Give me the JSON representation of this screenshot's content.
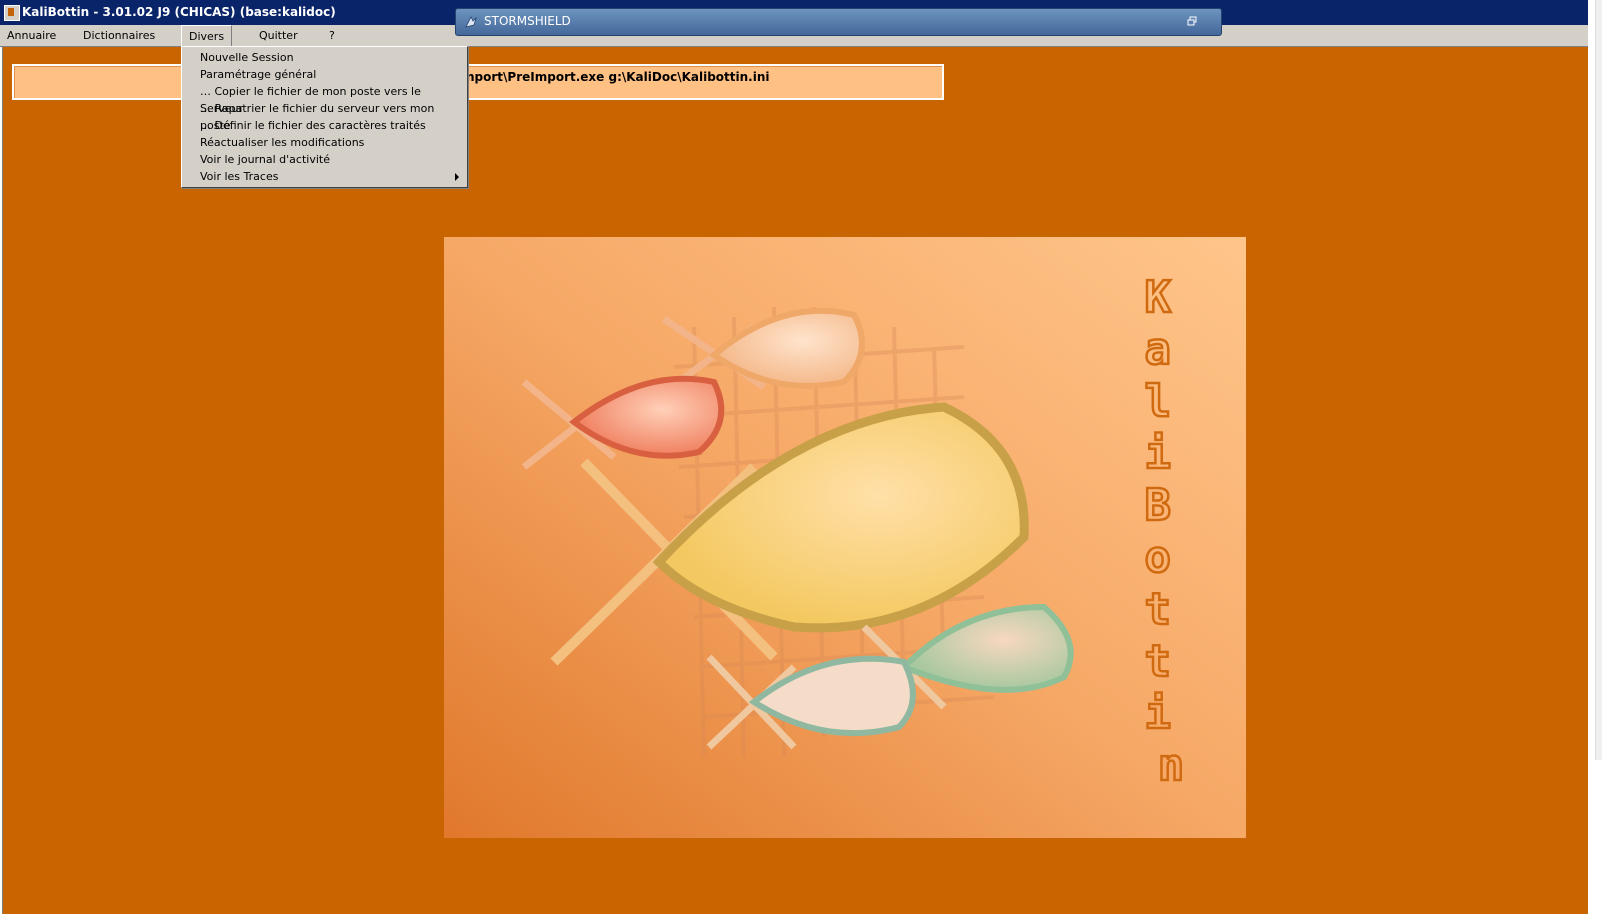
{
  "window": {
    "title": "KaliBottin - 3.01.02 J9 (CHICAS) (base:kalidoc)"
  },
  "menubar": {
    "items": [
      {
        "label": "Annuaire"
      },
      {
        "label": "Dictionnaires"
      },
      {
        "label": "Divers"
      },
      {
        "label": "Quitter"
      },
      {
        "label": "?"
      }
    ]
  },
  "dropdown": {
    "items": [
      {
        "label": "Nouvelle Session"
      },
      {
        "label": "Paramétrage général"
      },
      {
        "label": "… Copier le fichier de mon poste vers le Serveur"
      },
      {
        "label": "… Rapatrier le fichier du serveur vers mon poste"
      },
      {
        "label": "… Définir le fichier des caractères traités"
      },
      {
        "label": "Réactualiser les modifications"
      },
      {
        "label": "Voir le journal d'activité"
      },
      {
        "label": "Voir les Traces"
      }
    ]
  },
  "pathbar": {
    "text": "nport\\PreImport.exe g:\\KaliDoc\\Kalibottin.ini"
  },
  "stormshield": {
    "title": "STORMSHIELD"
  },
  "splash": {
    "logo_text": "KaliBottin",
    "colors": {
      "background": "#c96500",
      "splash_light": "#ffc083",
      "splash_dark": "#e07a30",
      "letter_outline": "#d06a10"
    }
  }
}
